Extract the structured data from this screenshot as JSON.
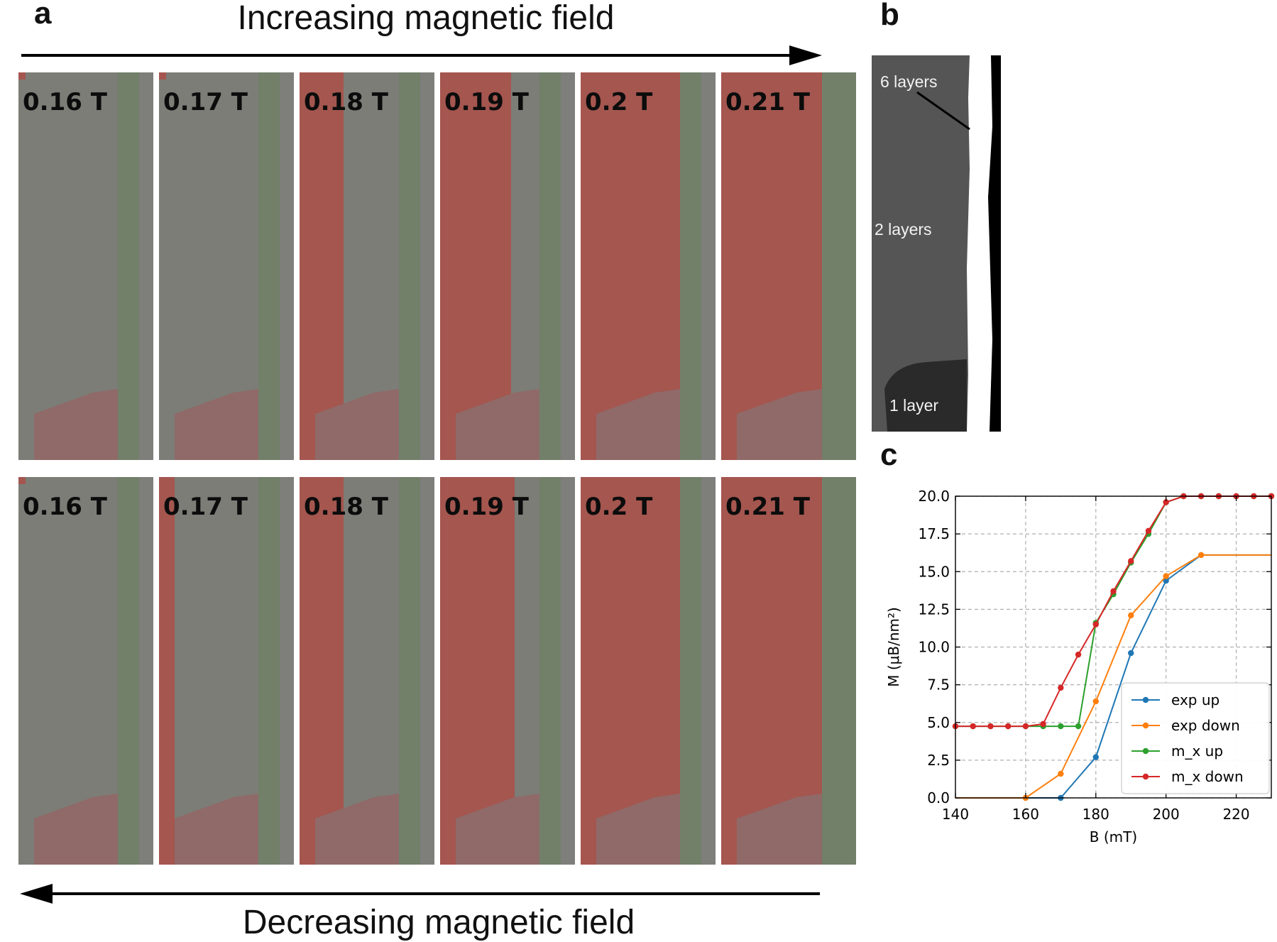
{
  "panel_labels": {
    "a": "a",
    "b": "b",
    "c": "c"
  },
  "arrows": {
    "increasing": "Increasing magnetic field",
    "decreasing": "Decreasing magnetic field"
  },
  "field_panels": {
    "top": [
      "0.16 T",
      "0.17 T",
      "0.18 T",
      "0.19 T",
      "0.2 T",
      "0.21 T"
    ],
    "bottom": [
      "0.16 T",
      "0.17 T",
      "0.18 T",
      "0.19 T",
      "0.2 T",
      "0.21 T"
    ]
  },
  "layers": {
    "six": "6 layers",
    "two": "2 layers",
    "one": "1 layer"
  },
  "colors": {
    "domain_red": "#a4564f",
    "domain_grey": "#7c7d77",
    "edge_green": "#727f69",
    "pink": "#8f6a68"
  },
  "chart_data": {
    "type": "line",
    "xlabel": "B (mT)",
    "ylabel": "M (μB/nm²)",
    "xlim": [
      140,
      230
    ],
    "ylim": [
      0,
      20
    ],
    "xticks": [
      140,
      160,
      180,
      200,
      220
    ],
    "yticks": [
      "0.0",
      "2.5",
      "5.0",
      "7.5",
      "10.0",
      "12.5",
      "15.0",
      "17.5",
      "20.0"
    ],
    "grid": true,
    "legend_position": "lower-right",
    "series": [
      {
        "name": "exp up",
        "color": "#1f77b4",
        "x": [
          140,
          170,
          180,
          190,
          200,
          210,
          230
        ],
        "y": [
          0,
          0,
          2.7,
          9.6,
          14.4,
          16.1,
          16.1
        ],
        "markers": [
          170,
          180,
          190,
          200
        ]
      },
      {
        "name": "exp down",
        "color": "#ff7f0e",
        "x": [
          140,
          160,
          170,
          180,
          190,
          200,
          210,
          230
        ],
        "y": [
          0,
          0,
          1.6,
          6.4,
          12.1,
          14.7,
          16.1,
          16.1
        ],
        "markers": [
          160,
          170,
          180,
          190,
          200,
          210
        ]
      },
      {
        "name": "m_x up",
        "color": "#2ca02c",
        "x": [
          140,
          145,
          150,
          155,
          160,
          165,
          170,
          175,
          180,
          185,
          190,
          195,
          200,
          205,
          210,
          215,
          220,
          225,
          230
        ],
        "y": [
          4.75,
          4.75,
          4.75,
          4.75,
          4.75,
          4.75,
          4.75,
          4.75,
          11.6,
          13.5,
          15.6,
          17.5,
          19.6,
          20.0,
          20.0,
          20.0,
          20.0,
          20.0,
          20.0
        ]
      },
      {
        "name": "m_x down",
        "color": "#d62728",
        "x": [
          140,
          145,
          150,
          155,
          160,
          165,
          170,
          175,
          180,
          185,
          190,
          195,
          200,
          205,
          210,
          215,
          220,
          225,
          230
        ],
        "y": [
          4.75,
          4.75,
          4.75,
          4.75,
          4.75,
          4.9,
          7.3,
          9.5,
          11.5,
          13.7,
          15.7,
          17.7,
          19.6,
          20.0,
          20.0,
          20.0,
          20.0,
          20.0,
          20.0
        ]
      }
    ]
  }
}
